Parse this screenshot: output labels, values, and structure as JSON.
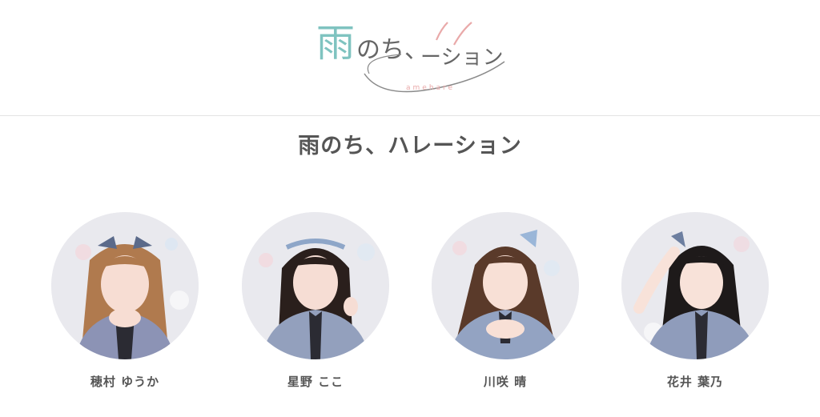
{
  "header": {
    "logo": {
      "text_main": "雨のち、ハレーション",
      "text_sub": "amehare",
      "colors": {
        "teal": "#7fc3c0",
        "pink": "#e9a9a9",
        "gray": "#666666"
      }
    }
  },
  "page": {
    "title": "雨のち、ハレーション"
  },
  "members": [
    {
      "name": "穂村 ゆうか",
      "hair": "#b07a4e",
      "bow": "#5b6a8a"
    },
    {
      "name": "星野 ここ",
      "hair": "#2a1f1c",
      "bow": "#8ea6c8"
    },
    {
      "name": "川咲 晴",
      "hair": "#5a3a2a",
      "bow": "#9ab6d8"
    },
    {
      "name": "花井 葉乃",
      "hair": "#1e1a1a",
      "bow": "#6d7fa0"
    }
  ],
  "colors": {
    "title": "#555555",
    "divider": "#e3e3e3",
    "photo_bg": "#e9e9ee"
  }
}
